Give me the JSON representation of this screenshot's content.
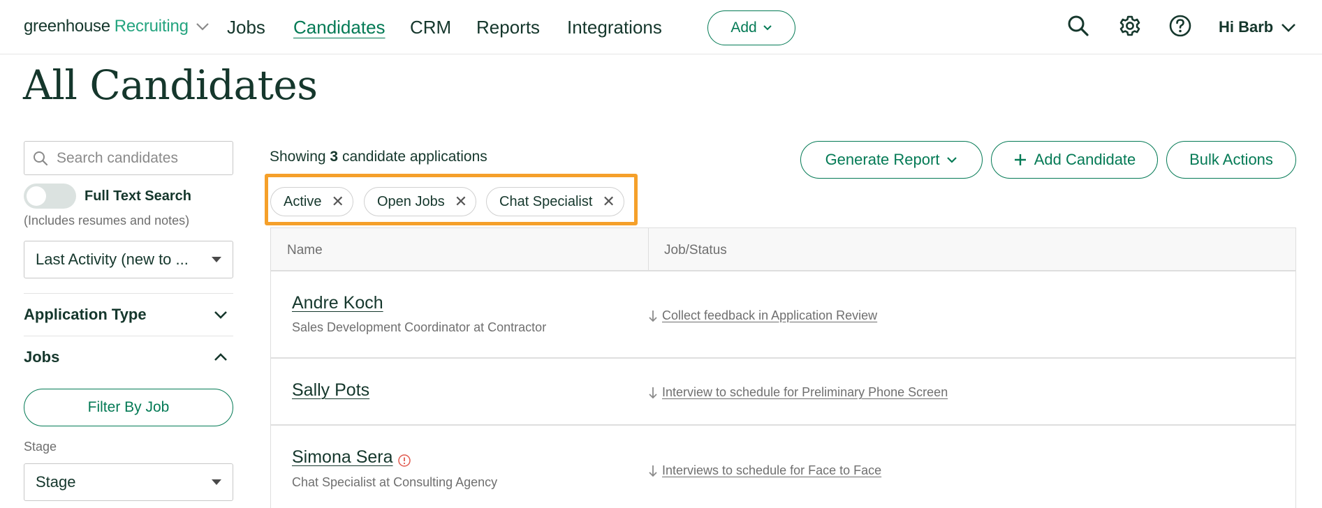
{
  "nav": {
    "logo_main": "greenhouse",
    "logo_product": "Recruiting",
    "links": [
      "Jobs",
      "Candidates",
      "CRM",
      "Reports",
      "Integrations"
    ],
    "active_link": "Candidates",
    "add_label": "Add",
    "greeting": "Hi Barb",
    "icons": [
      "search-icon",
      "gear-icon",
      "help-icon",
      "chevron-down-icon"
    ]
  },
  "page": {
    "title": "All Candidates"
  },
  "sidebar": {
    "search_placeholder": "Search candidates",
    "full_text_label": "Full Text Search",
    "full_text_note": "(Includes resumes and notes)",
    "full_text_enabled": false,
    "sort_value": "Last Activity (new to ...",
    "application_type_label": "Application Type",
    "jobs_label": "Jobs",
    "filter_by_job_label": "Filter By Job",
    "stage_label": "Stage",
    "stage_value": "Stage"
  },
  "main": {
    "showing_prefix": "Showing",
    "showing_count": "3",
    "showing_suffix": "candidate applications",
    "generate_report_label": "Generate Report",
    "add_candidate_label": "Add Candidate",
    "bulk_actions_label": "Bulk Actions",
    "filters": [
      "Active",
      "Open Jobs",
      "Chat Specialist"
    ],
    "columns": [
      "Name",
      "Job/Status"
    ],
    "rows": [
      {
        "name": "Andre Koch",
        "subtitle": "Sales Development Coordinator at Contractor",
        "status": "Collect feedback in Application Review",
        "alert": false
      },
      {
        "name": "Sally Pots",
        "subtitle": "",
        "status": "Interview to schedule for Preliminary Phone Screen",
        "alert": false
      },
      {
        "name": "Simona Sera",
        "subtitle": "Chat Specialist at Consulting Agency",
        "status": "Interviews to schedule for Face to Face",
        "alert": true
      }
    ]
  },
  "colors": {
    "brand_green": "#047a55",
    "dark_text": "#15372c",
    "highlight": "#f5a02a",
    "alert": "#e05a4f"
  }
}
